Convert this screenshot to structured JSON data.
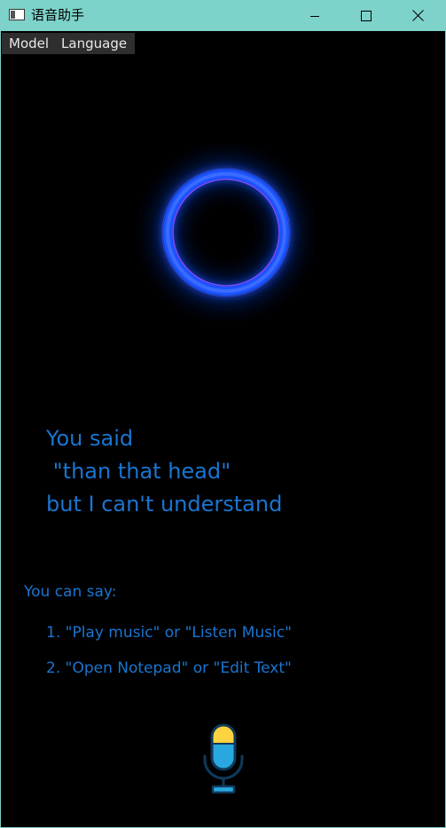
{
  "window": {
    "title": "语音助手",
    "controls": {
      "minimize_icon": "minimize-icon",
      "maximize_icon": "maximize-icon",
      "close_icon": "close-icon"
    }
  },
  "menu": {
    "items": [
      {
        "label": "Model"
      },
      {
        "label": "Language"
      }
    ]
  },
  "assistant": {
    "ring_color": "#2f6bff",
    "response_lines": [
      "You said",
      " \"than that head\"",
      "but I can't understand"
    ]
  },
  "hints": {
    "title": "You can say:",
    "items": [
      "1. \"Play music\" or \"Listen Music\"",
      "2. \"Open Notepad\" or \"Edit Text\""
    ]
  },
  "microphone": {
    "icon": "microphone-icon",
    "colors": {
      "top": "#ffd23f",
      "bottom": "#29a8e0",
      "outline": "#0e3a5b"
    }
  },
  "colors": {
    "titlebar": "#7dd3c9",
    "text_accent": "#1a75d0",
    "background": "#000000"
  }
}
